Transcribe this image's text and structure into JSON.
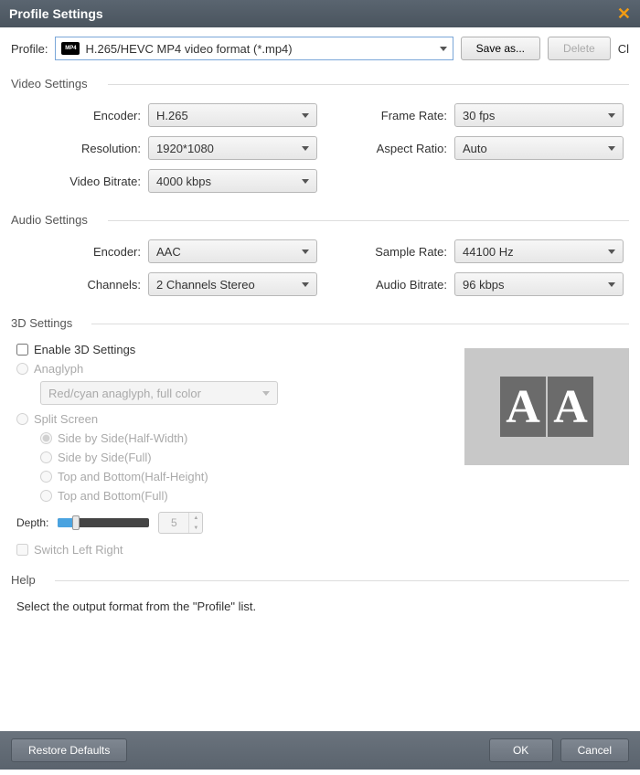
{
  "title": "Profile Settings",
  "profile": {
    "label": "Profile:",
    "badge": "MP4",
    "value": "H.265/HEVC MP4 video format (*.mp4)",
    "save_as": "Save as...",
    "delete": "Delete",
    "extra": "Cl"
  },
  "video": {
    "heading": "Video Settings",
    "encoder_label": "Encoder:",
    "encoder": "H.265",
    "resolution_label": "Resolution:",
    "resolution": "1920*1080",
    "bitrate_label": "Video Bitrate:",
    "bitrate": "4000 kbps",
    "framerate_label": "Frame Rate:",
    "framerate": "30 fps",
    "aspect_label": "Aspect Ratio:",
    "aspect": "Auto"
  },
  "audio": {
    "heading": "Audio Settings",
    "encoder_label": "Encoder:",
    "encoder": "AAC",
    "channels_label": "Channels:",
    "channels": "2 Channels Stereo",
    "samplerate_label": "Sample Rate:",
    "samplerate": "44100 Hz",
    "bitrate_label": "Audio Bitrate:",
    "bitrate": "96 kbps"
  },
  "threed": {
    "heading": "3D Settings",
    "enable": "Enable 3D Settings",
    "anaglyph": "Anaglyph",
    "anaglyph_value": "Red/cyan anaglyph, full color",
    "split": "Split Screen",
    "sbs_half": "Side by Side(Half-Width)",
    "sbs_full": "Side by Side(Full)",
    "tb_half": "Top and Bottom(Half-Height)",
    "tb_full": "Top and Bottom(Full)",
    "depth_label": "Depth:",
    "depth_value": "5",
    "switch_lr": "Switch Left Right",
    "preview_a": "A",
    "preview_b": "A"
  },
  "help": {
    "heading": "Help",
    "text": "Select the output format from the \"Profile\" list."
  },
  "footer": {
    "restore": "Restore Defaults",
    "ok": "OK",
    "cancel": "Cancel"
  }
}
